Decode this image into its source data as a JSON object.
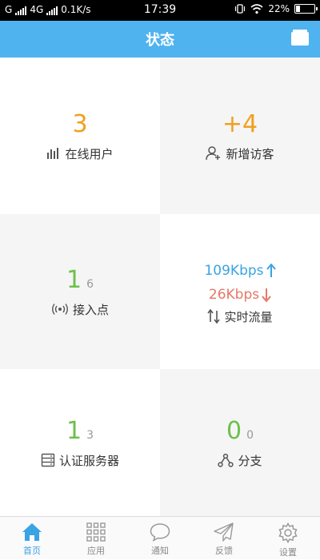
{
  "status_bar": {
    "carrier1": "G",
    "carrier2": "4G",
    "speed": "0.1K/s",
    "time": "17:39",
    "battery": "22%",
    "battery_level": 0.22
  },
  "header": {
    "title": "状态"
  },
  "cells": {
    "online_users": {
      "value": "3",
      "label": "在线用户"
    },
    "new_visitors": {
      "value": "+4",
      "label": "新增访客"
    },
    "access_points": {
      "value": "1",
      "sub": "6",
      "label": "接入点"
    },
    "traffic": {
      "up": "109Kbps",
      "down": "26Kbps",
      "label": "实时流量"
    },
    "auth_servers": {
      "value": "1",
      "sub": "3",
      "label": "认证服务器"
    },
    "branches": {
      "value": "0",
      "sub": "0",
      "label": "分支"
    }
  },
  "tabbar": {
    "items": [
      {
        "label": "首页",
        "icon": "home-icon"
      },
      {
        "label": "应用",
        "icon": "grid-icon"
      },
      {
        "label": "通知",
        "icon": "chat-bubble-icon"
      },
      {
        "label": "反馈",
        "icon": "paper-plane-icon"
      },
      {
        "label": "设置",
        "icon": "gear-icon"
      }
    ]
  },
  "colors": {
    "primary": "#4fb3f0",
    "orange": "#f0a020",
    "green": "#6cc04a",
    "up": "#3aa3e3",
    "down": "#e57868"
  }
}
